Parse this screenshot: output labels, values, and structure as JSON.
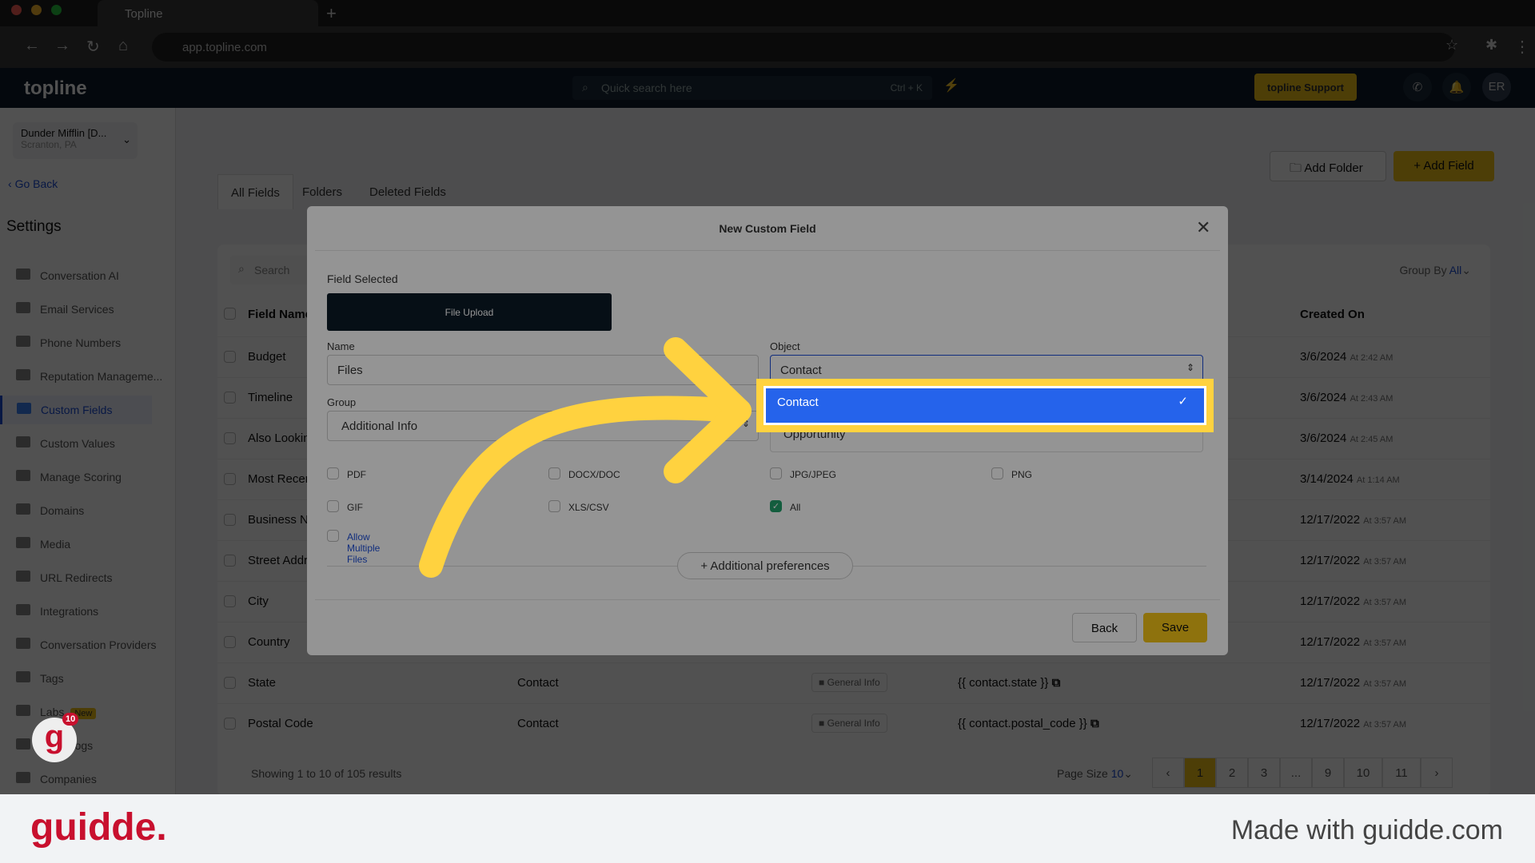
{
  "browser": {
    "tab_title": "Topline",
    "url": "app.topline.com"
  },
  "header": {
    "logo": "topline",
    "search_placeholder": "Quick search here",
    "search_shortcut": "Ctrl + K",
    "support_label": "topline Support",
    "avatar": "ER"
  },
  "sidebar": {
    "account_name": "Dunder Mifflin [D...",
    "account_location": "Scranton, PA",
    "go_back": "Go Back",
    "title": "Settings",
    "items": [
      {
        "label": "Conversation AI"
      },
      {
        "label": "Email Services"
      },
      {
        "label": "Phone Numbers"
      },
      {
        "label": "Reputation Manageme..."
      },
      {
        "label": "Custom Fields",
        "active": true
      },
      {
        "label": "Custom Values"
      },
      {
        "label": "Manage Scoring"
      },
      {
        "label": "Domains"
      },
      {
        "label": "Media"
      },
      {
        "label": "URL Redirects"
      },
      {
        "label": "Integrations"
      },
      {
        "label": "Conversation Providers"
      },
      {
        "label": "Tags"
      },
      {
        "label": "Labs",
        "badge": "New"
      },
      {
        "label": "Audit Logs"
      },
      {
        "label": "Companies"
      }
    ]
  },
  "page": {
    "tabs": [
      "All Fields",
      "Folders",
      "Deleted Fields"
    ],
    "add_folder": "Add Folder",
    "add_field": "+ Add Field",
    "search_placeholder": "Search",
    "group_by_label": "Group By",
    "group_by_value": "All",
    "columns": {
      "field_name": "Field Name",
      "created_on": "Created On"
    },
    "rows": [
      {
        "name": "Budget",
        "object": "",
        "folder": "",
        "key": "",
        "date": "3/6/2024",
        "time": "At 2:42 AM"
      },
      {
        "name": "Timeline",
        "object": "",
        "folder": "",
        "key": "",
        "date": "3/6/2024",
        "time": "At 2:43 AM"
      },
      {
        "name": "Also Looking",
        "object": "",
        "folder": "",
        "key": "",
        "date": "3/6/2024",
        "time": "At 2:45 AM"
      },
      {
        "name": "Most Recent",
        "object": "",
        "folder": "",
        "key": "",
        "date": "3/14/2024",
        "time": "At 1:14 AM"
      },
      {
        "name": "Business Name",
        "object": "",
        "folder": "",
        "key": "",
        "date": "12/17/2022",
        "time": "At 3:57 AM"
      },
      {
        "name": "Street Address",
        "object": "",
        "folder": "",
        "key": "",
        "date": "12/17/2022",
        "time": "At 3:57 AM"
      },
      {
        "name": "City",
        "object": "",
        "folder": "",
        "key": "",
        "date": "12/17/2022",
        "time": "At 3:57 AM"
      },
      {
        "name": "Country",
        "object": "",
        "folder": "",
        "key": "",
        "date": "12/17/2022",
        "time": "At 3:57 AM"
      },
      {
        "name": "State",
        "object": "Contact",
        "folder": "General Info",
        "key": "{{ contact.state }}",
        "date": "12/17/2022",
        "time": "At 3:57 AM"
      },
      {
        "name": "Postal Code",
        "object": "Contact",
        "folder": "General Info",
        "key": "{{ contact.postal_code }}",
        "date": "12/17/2022",
        "time": "At 3:57 AM"
      }
    ],
    "showing": "Showing 1 to 10 of 105 results",
    "page_size_label": "Page Size",
    "page_size": "10",
    "pages": [
      "‹",
      "1",
      "2",
      "3",
      "...",
      "9",
      "10",
      "11",
      "›"
    ],
    "current_page": "1"
  },
  "modal": {
    "title": "New Custom Field",
    "field_selected_label": "Field Selected",
    "field_type": "File Upload",
    "name_label": "Name",
    "name_value": "Files",
    "object_label": "Object",
    "object_value": "Contact",
    "group_label": "Group",
    "group_value": "Additional Info",
    "object_options": [
      {
        "label": "Contact",
        "selected": true
      },
      {
        "label": "Opportunity"
      }
    ],
    "file_types": [
      {
        "label": "PDF",
        "checked": false
      },
      {
        "label": "DOCX/DOC",
        "checked": false
      },
      {
        "label": "JPG/JPEG",
        "checked": false
      },
      {
        "label": "PNG",
        "checked": false
      },
      {
        "label": "GIF",
        "checked": false
      },
      {
        "label": "XLS/CSV",
        "checked": false
      },
      {
        "label": "All",
        "checked": true
      }
    ],
    "allow_multiple": "Allow Multiple Files",
    "additional_prefs": "Additional preferences",
    "back": "Back",
    "save": "Save"
  },
  "guidde": {
    "logo": "guidde.",
    "badge": "10",
    "made_with": "Made with guidde.com"
  },
  "colors": {
    "accent": "#f5c518",
    "highlight": "#ffd23f",
    "selected": "#2563eb"
  }
}
